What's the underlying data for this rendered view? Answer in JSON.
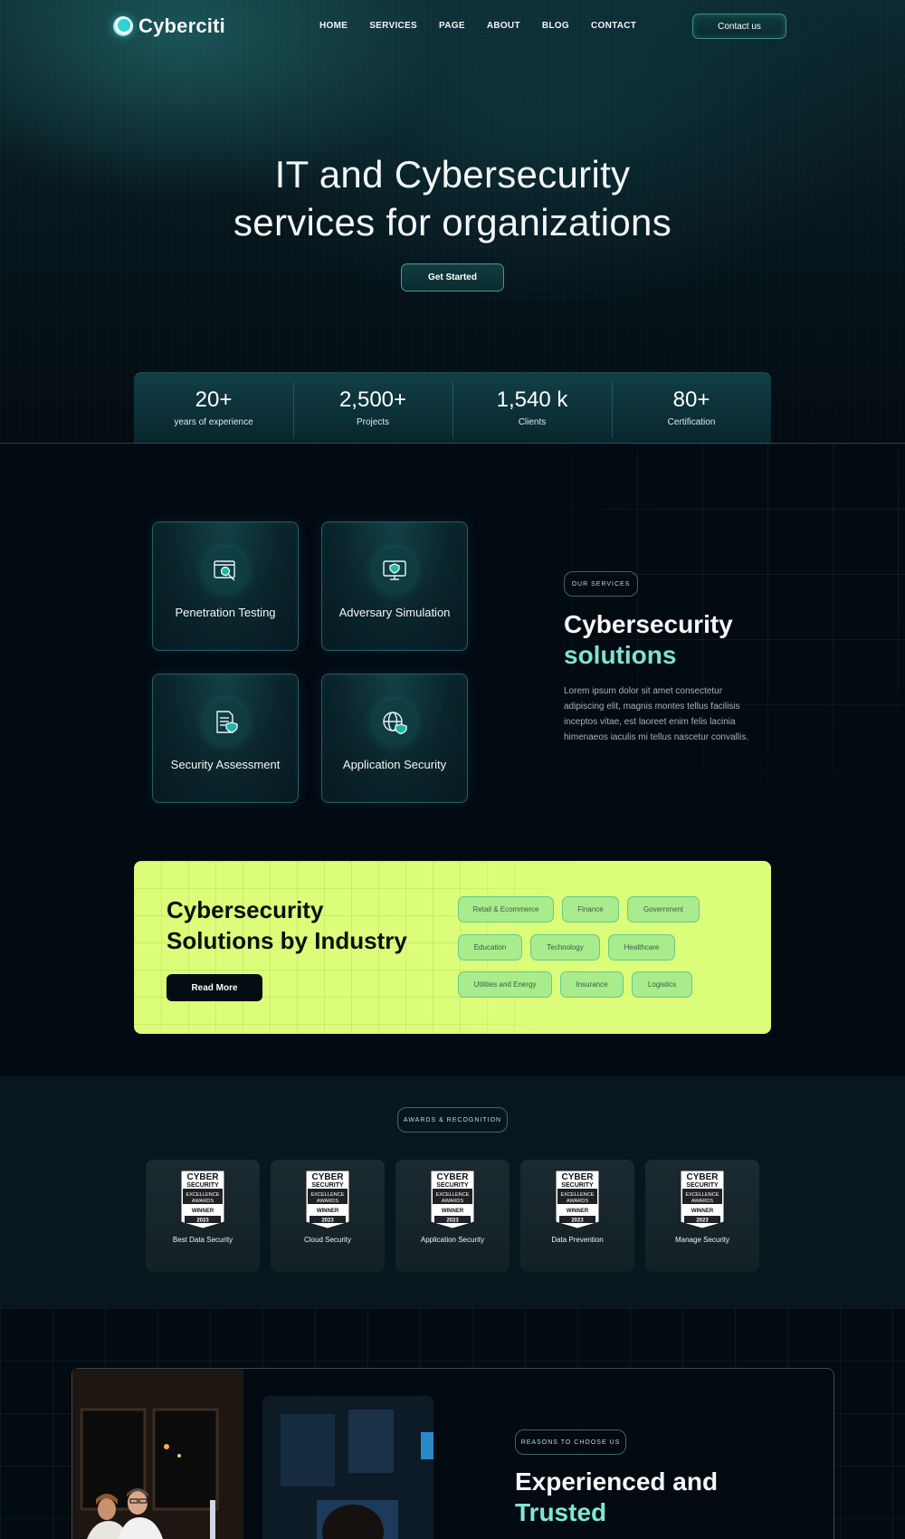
{
  "brand": {
    "name": "Cyberciti"
  },
  "nav": {
    "items": [
      "HOME",
      "SERVICES",
      "PAGE",
      "ABOUT",
      "BLOG",
      "CONTACT"
    ],
    "cta": "Contact us"
  },
  "hero": {
    "title_line1": "IT and Cybersecurity",
    "title_line2": "services for organizations",
    "cta": "Get Started"
  },
  "stats": [
    {
      "value": "20+",
      "label": "years of experience"
    },
    {
      "value": "2,500+",
      "label": "Projects"
    },
    {
      "value": "1,540 k",
      "label": "Clients"
    },
    {
      "value": "80+",
      "label": "Certification"
    }
  ],
  "services": {
    "tag": "OUR SERVICES",
    "heading_white": "Cybersecurity",
    "heading_accent": "solutions",
    "description": "Lorem ipsum dolor sit amet consectetur adipiscing elit, magnis montes tellus facilisis inceptos vitae, est  laoreet enim felis lacinia himenaeos iaculis mi tellus nascetur convallis.",
    "cards": [
      {
        "label": "Penetration Testing",
        "icon": "browser-search-icon"
      },
      {
        "label": "Adversary Simulation",
        "icon": "monitor-shield-icon"
      },
      {
        "label": "Security Assessment",
        "icon": "document-shield-icon"
      },
      {
        "label": "Application Security",
        "icon": "globe-shield-icon"
      }
    ]
  },
  "industry": {
    "title_line1": "Cybersecurity",
    "title_line2": "Solutions by Industry",
    "cta": "Read More",
    "tags": [
      "Retail & Ecommerce",
      "Finance",
      "Government",
      "Education",
      "Technology",
      "Healthcare",
      "Utilities and Energy",
      "Insurance",
      "Logistics"
    ]
  },
  "awards": {
    "tag": "AWARDS & RECOGNITION",
    "badge_lines": [
      "CYBER",
      "SECURITY",
      "EXCELLENCE",
      "AWARDS",
      "WINNER",
      "2023"
    ],
    "items": [
      "Best Data Security",
      "Cloud Security",
      "Application Security",
      "Data Prevention",
      "Manage Security"
    ]
  },
  "reasons": {
    "tag": "REASONS TO CHOOSE US",
    "heading_white": "Experienced and",
    "heading_accent": "Trusted"
  },
  "colors": {
    "accent_teal": "#7fe3d0",
    "industry_bg": "#dcfd79",
    "page_bg": "#020a12"
  }
}
